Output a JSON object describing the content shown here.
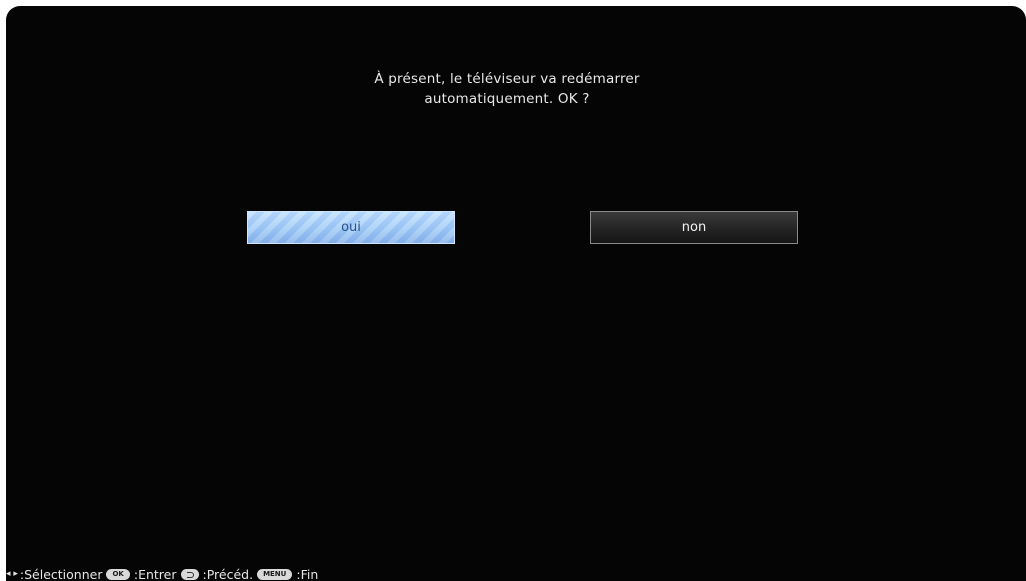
{
  "dialog": {
    "message_line1": "À présent, le téléviseur va redémarrer",
    "message_line2": "automatiquement. OK ?"
  },
  "buttons": {
    "yes_label": "oui",
    "no_label": "non"
  },
  "footer": {
    "arrows": "◂ ▸",
    "select_label": ":Sélectionner",
    "ok_key": "OK",
    "enter_label": ":Entrer",
    "back_key_icon": "return-icon",
    "back_label": ":Précéd.",
    "menu_key": "MENU",
    "end_label": ":Fin"
  },
  "colors": {
    "background": "#050505",
    "selected_button": "#9fcaf6",
    "unselected_button": "#242424"
  }
}
